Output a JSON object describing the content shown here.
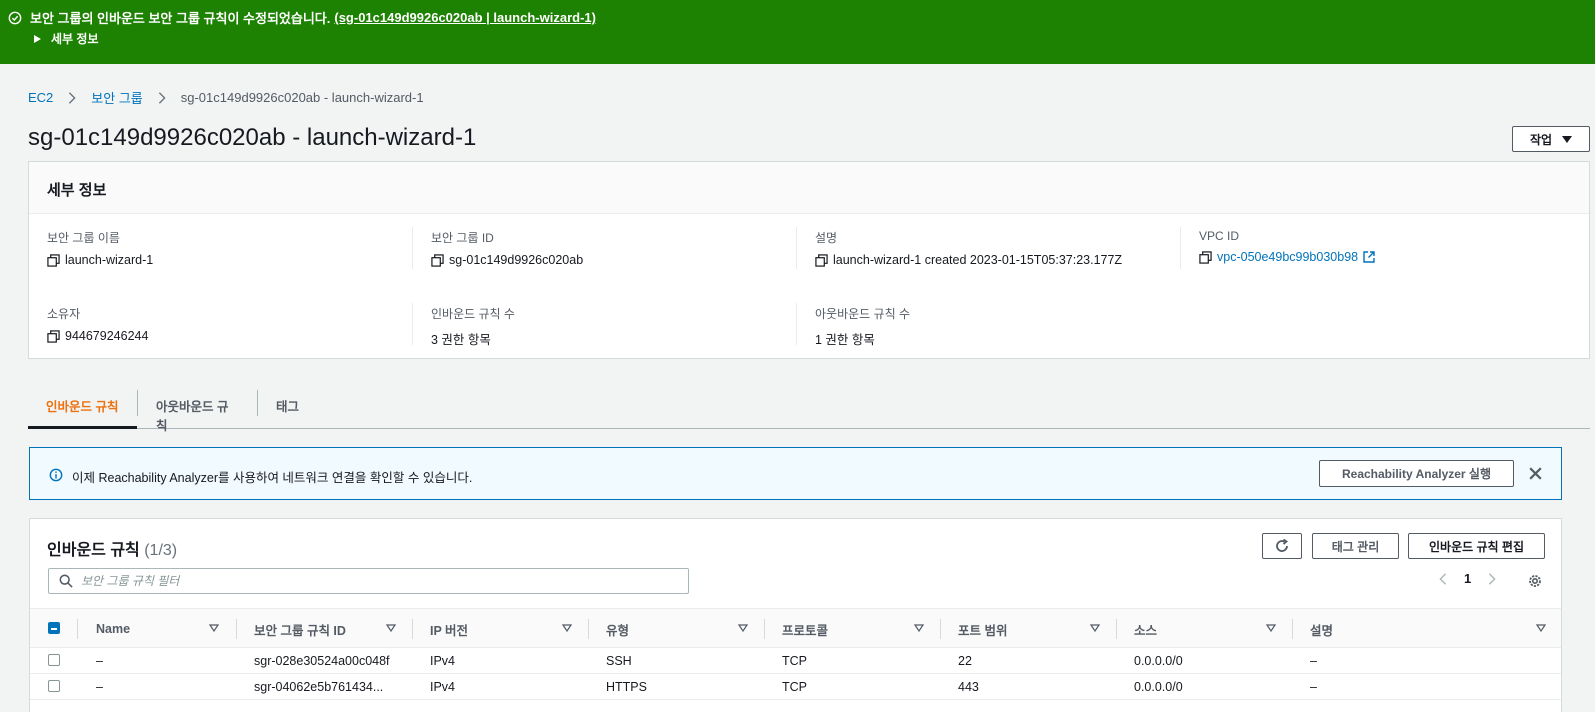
{
  "banner": {
    "message": "보안 그룹의 인바운드 보안 그룹 규칙이 수정되었습니다.",
    "link": "(sg-01c149d9926c020ab | launch-wizard-1)",
    "details_label": "세부 정보"
  },
  "breadcrumb": {
    "items": [
      "EC2",
      "보안 그룹"
    ],
    "current": "sg-01c149d9926c020ab - launch-wizard-1"
  },
  "page": {
    "title": "sg-01c149d9926c020ab - launch-wizard-1",
    "actions_label": "작업"
  },
  "details": {
    "header": "세부 정보",
    "fields": [
      {
        "label": "보안 그룹 이름",
        "value": "launch-wizard-1"
      },
      {
        "label": "보안 그룹 ID",
        "value": "sg-01c149d9926c020ab"
      },
      {
        "label": "설명",
        "value": "launch-wizard-1 created 2023-01-15T05:37:23.177Z"
      },
      {
        "label": "VPC ID",
        "value": "vpc-050e49bc99b030b98"
      },
      {
        "label": "소유자",
        "value": "944679246244"
      },
      {
        "label": "인바운드 규칙 수",
        "value": "3 권한 항목"
      },
      {
        "label": "아웃바운드 규칙 수",
        "value": "1 권한 항목"
      }
    ]
  },
  "tabs": [
    {
      "label": "인바운드 규칙",
      "active": true
    },
    {
      "label": "아웃바운드 규칙",
      "active": false
    },
    {
      "label": "태그",
      "active": false
    }
  ],
  "alert": {
    "text": "이제 Reachability Analyzer를 사용하여 네트워크 연결을 확인할 수 있습니다.",
    "button": "Reachability Analyzer 실행"
  },
  "rules": {
    "title": "인바운드 규칙",
    "count": "(1/3)",
    "manage_tags_label": "태그 관리",
    "edit_label": "인바운드 규칙 편집",
    "search_placeholder": "보안 그룹 규칙 필터",
    "page": "1",
    "columns": [
      "Name",
      "보안 그룹 규칙 ID",
      "IP 버전",
      "유형",
      "프로토콜",
      "포트 범위",
      "소스",
      "설명"
    ],
    "rows": [
      [
        "–",
        "sgr-028e30524a00c048f",
        "IPv4",
        "SSH",
        "TCP",
        "22",
        "0.0.0.0/0",
        "–"
      ],
      [
        "–",
        "sgr-04062e5b761434...",
        "IPv4",
        "HTTPS",
        "TCP",
        "443",
        "0.0.0.0/0",
        "–"
      ]
    ]
  },
  "colors": {
    "success": "#1d8102",
    "link": "#0073bb",
    "active_tab": "#ec7211"
  },
  "icons": [
    "check-circle-icon",
    "caret-right-icon",
    "chevron-right-icon",
    "copy-icon",
    "external-link-icon",
    "info-icon",
    "close-icon",
    "refresh-icon",
    "search-icon",
    "chevron-left-icon",
    "settings-icon",
    "sort-down-icon"
  ]
}
